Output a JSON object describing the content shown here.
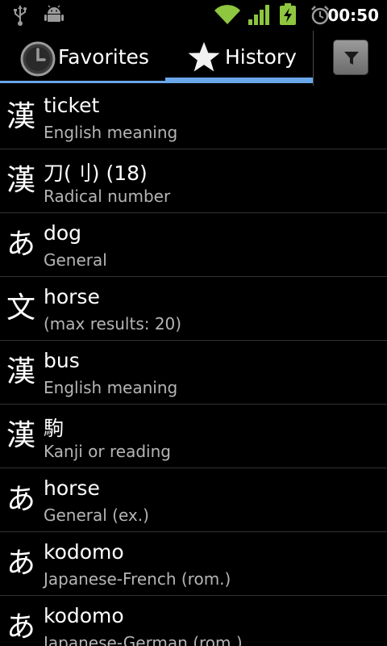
{
  "status_bar": {
    "time": "00:50",
    "icons": [
      "usb-icon",
      "android-icon",
      "wifi-icon",
      "signal-icon",
      "battery-charging-icon",
      "alarm-icon"
    ],
    "colors": {
      "wifi": "#8ec63f",
      "signal": "#8ec63f",
      "battery": "#8ec63f"
    }
  },
  "tabs": [
    {
      "label": "Favorites",
      "icon": "clock-icon",
      "selected": false
    },
    {
      "label": "History",
      "icon": "star-icon",
      "selected": true
    }
  ],
  "toolbar": {
    "filter_icon": "filter-icon"
  },
  "accent_color": "#6aa7ea",
  "history": [
    {
      "icon_glyph": "漢",
      "title": "ticket",
      "subtitle": "English meaning"
    },
    {
      "icon_glyph": "漢",
      "title": "刀(刂) (18)",
      "subtitle": "Radical number"
    },
    {
      "icon_glyph": "あ",
      "title": "dog",
      "subtitle": "General"
    },
    {
      "icon_glyph": "文",
      "title": "horse",
      "subtitle": "(max results: 20)"
    },
    {
      "icon_glyph": "漢",
      "title": "bus",
      "subtitle": "English meaning"
    },
    {
      "icon_glyph": "漢",
      "title": "駒",
      "subtitle": "Kanji or reading"
    },
    {
      "icon_glyph": "あ",
      "title": "horse",
      "subtitle": "General (ex.)"
    },
    {
      "icon_glyph": "あ",
      "title": "kodomo",
      "subtitle": "Japanese-French (rom.)"
    },
    {
      "icon_glyph": "あ",
      "title": "kodomo",
      "subtitle": "Japanese-German (rom.)"
    }
  ]
}
